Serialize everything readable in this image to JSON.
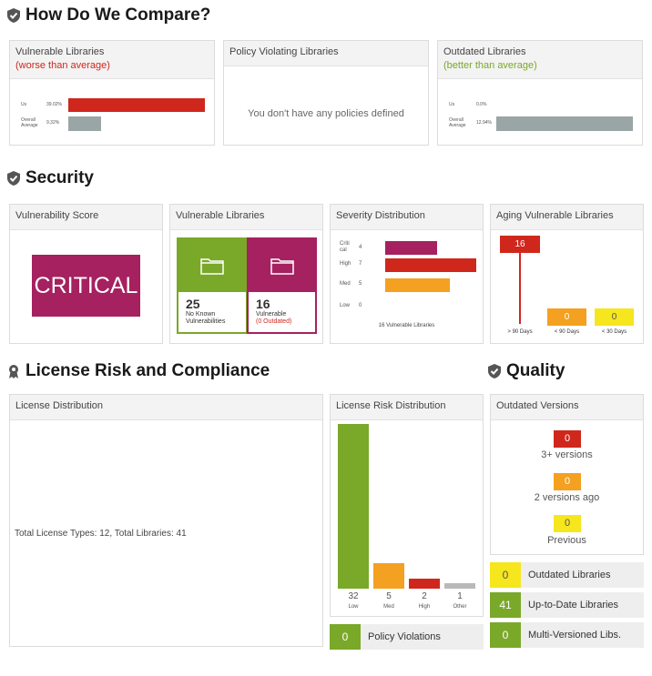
{
  "compare": {
    "title": "How Do We Compare?",
    "vulnerable": {
      "title": "Vulnerable Libraries",
      "subtitle": "(worse than average)",
      "us_label": "Us",
      "us_value": "39.02%",
      "avg_label_1": "Overall",
      "avg_label_2": "Average",
      "avg_value": "9.32%",
      "us_fraction": 0.3902,
      "avg_fraction": 0.0932
    },
    "policy": {
      "title": "Policy Violating Libraries",
      "message": "You don't have any policies defined"
    },
    "outdated": {
      "title": "Outdated Libraries",
      "subtitle": "(better than average)",
      "us_label": "Us",
      "us_value": "0.0%",
      "avg_label_1": "Overall",
      "avg_label_2": "Average",
      "avg_value": "12.94%",
      "us_fraction": 0.0,
      "avg_fraction": 0.1294
    }
  },
  "security": {
    "title": "Security",
    "score": {
      "title": "Vulnerability Score",
      "value": "CRITICAL"
    },
    "vuln_libs": {
      "title": "Vulnerable Libraries",
      "left_num": "25",
      "left_line1": "No Known",
      "left_line2": "Vulnerabilities",
      "right_num": "16",
      "right_line1": "Vulnerable",
      "right_line2": "(0 Outdated)"
    },
    "severity": {
      "title": "Severity Distribution",
      "rows": [
        {
          "label1": "Criti",
          "label2": "cal",
          "count": "4",
          "value": 4
        },
        {
          "label1": "High",
          "label2": "",
          "count": "7",
          "value": 7
        },
        {
          "label1": "Med",
          "label2": "",
          "count": "5",
          "value": 5
        },
        {
          "label1": "Low",
          "label2": "",
          "count": "0",
          "value": 0
        }
      ],
      "footer": "16 Vulnerable Libraries"
    },
    "aging": {
      "title": "Aging Vulnerable Libraries",
      "buckets": [
        {
          "label": "> 90 Days",
          "count": "16"
        },
        {
          "label": "< 90 Days",
          "count": "0"
        },
        {
          "label": "< 30 Days",
          "count": "0"
        }
      ]
    }
  },
  "license": {
    "title": "License Risk and Compliance",
    "distribution": {
      "title": "License Distribution",
      "summary": "Total License Types: 12, Total Libraries: 41"
    },
    "risk": {
      "title": "License Risk Distribution",
      "bars": [
        {
          "count": "32",
          "label": "Low",
          "value": 32
        },
        {
          "count": "5",
          "label": "Med",
          "value": 5
        },
        {
          "count": "2",
          "label": "High",
          "value": 2
        },
        {
          "count": "1",
          "label": "Other",
          "value": 1
        }
      ],
      "policy_count": "0",
      "policy_label": "Policy Violations"
    }
  },
  "quality": {
    "title": "Quality",
    "outdated_versions": {
      "title": "Outdated Versions",
      "items": [
        {
          "count": "0",
          "label": "3+ versions"
        },
        {
          "count": "0",
          "label": "2 versions ago"
        },
        {
          "count": "0",
          "label": "Previous"
        }
      ]
    },
    "summary": [
      {
        "count": "0",
        "label": "Outdated Libraries"
      },
      {
        "count": "41",
        "label": "Up-to-Date Libraries"
      },
      {
        "count": "0",
        "label": "Multi-Versioned Libs."
      }
    ]
  },
  "colors": {
    "red": "#d0271d",
    "green": "#7aa829",
    "magenta": "#a52160",
    "orange": "#f4a020",
    "yellow": "#f6e61d",
    "gray": "#9aa5a6",
    "lightgray": "#b9b9b9"
  }
}
